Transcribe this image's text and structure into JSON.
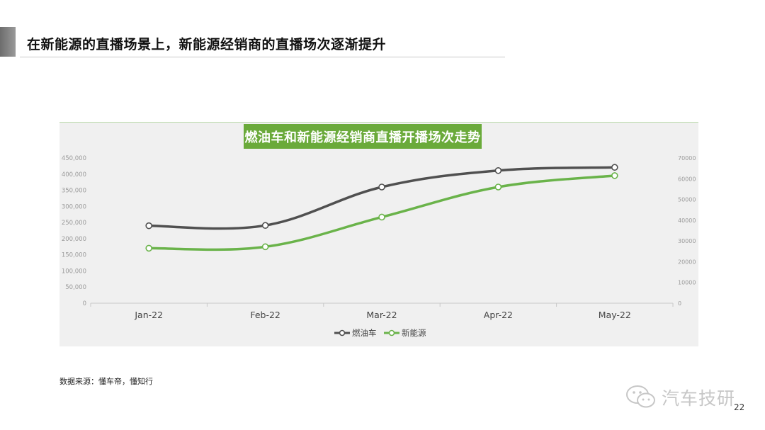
{
  "slide": {
    "headline": "在新能源的直播场景上，新能源经销商的直播场次逐渐提升",
    "source": "数据来源：懂车帝，懂知行",
    "watermark": "汽车技研",
    "page_number": "22"
  },
  "chart_data": {
    "type": "line",
    "title": "燃油车和新能源经销商直播开播场次走势",
    "categories": [
      "Jan-22",
      "Feb-22",
      "Mar-22",
      "Apr-22",
      "May-22"
    ],
    "series": [
      {
        "name": "燃油车",
        "axis": "left",
        "color": "#505050",
        "values": [
          240000,
          241000,
          360000,
          411000,
          421000
        ]
      },
      {
        "name": "新能源",
        "axis": "right",
        "color": "#6ab34a",
        "values": [
          26500,
          27200,
          41500,
          56000,
          61500
        ]
      }
    ],
    "y_left": {
      "min": 0,
      "max": 450000,
      "ticks": [
        "0",
        "50,000",
        "100,000",
        "150,000",
        "200,000",
        "250,000",
        "300,000",
        "350,000",
        "400,000",
        "450,000"
      ]
    },
    "y_right": {
      "min": 0,
      "max": 70000,
      "ticks": [
        "0",
        "10000",
        "20000",
        "30000",
        "40000",
        "50000",
        "60000",
        "70000"
      ]
    },
    "grid": false,
    "legend_position": "bottom"
  }
}
